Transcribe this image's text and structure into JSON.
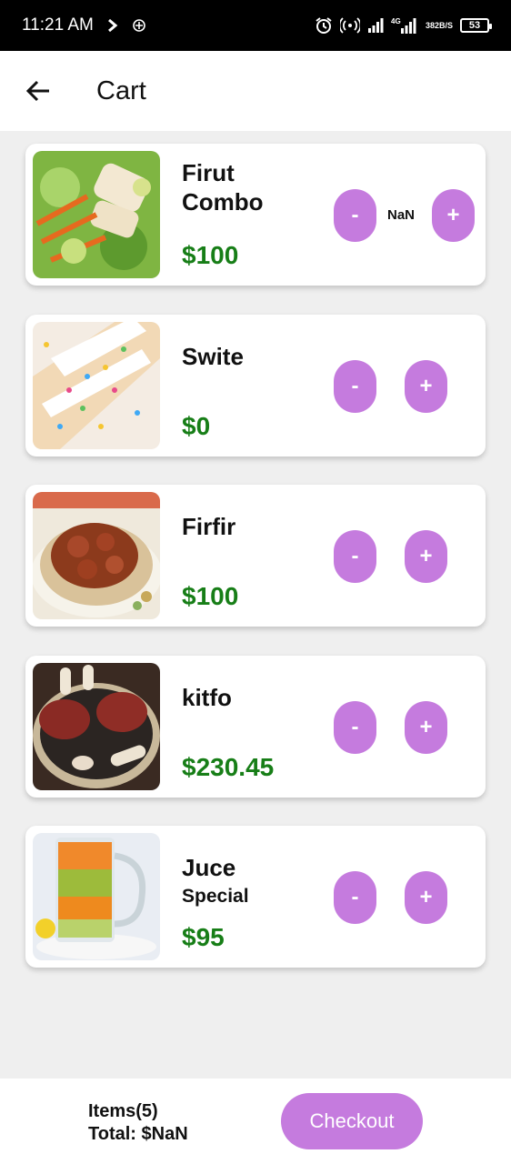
{
  "status_bar": {
    "time": "11:21 AM",
    "network_speed_top": "382",
    "network_speed_bottom": "B/S",
    "battery": "53",
    "icons": [
      "chevron-right-icon",
      "location-target-icon",
      "alarm-icon",
      "hotspot-icon",
      "signal-icon",
      "4g-signal-icon",
      "battery-icon"
    ]
  },
  "header": {
    "title": "Cart",
    "back_icon": "arrow-left-icon"
  },
  "cart": {
    "items": [
      {
        "name": "Firut Combo",
        "subtitle": "",
        "price": "$100",
        "quantity": "NaN",
        "minus_label": "-",
        "plus_label": "+"
      },
      {
        "name": "Swite",
        "subtitle": "",
        "price": "$0",
        "quantity": "",
        "minus_label": "-",
        "plus_label": "+"
      },
      {
        "name": "Firfir",
        "subtitle": "",
        "price": "$100",
        "quantity": "",
        "minus_label": "-",
        "plus_label": "+"
      },
      {
        "name": "kitfo",
        "subtitle": "",
        "price": "$230.45",
        "quantity": "",
        "minus_label": "-",
        "plus_label": "+"
      },
      {
        "name": "Juce",
        "subtitle": "Special",
        "price": "$95",
        "quantity": "",
        "minus_label": "-",
        "plus_label": "+"
      }
    ]
  },
  "footer": {
    "items_count": "Items(5)",
    "total": "Total: $NaN",
    "checkout_label": "Checkout"
  },
  "colors": {
    "accent": "#c57bde",
    "price": "#177e17",
    "background": "#efefef"
  }
}
